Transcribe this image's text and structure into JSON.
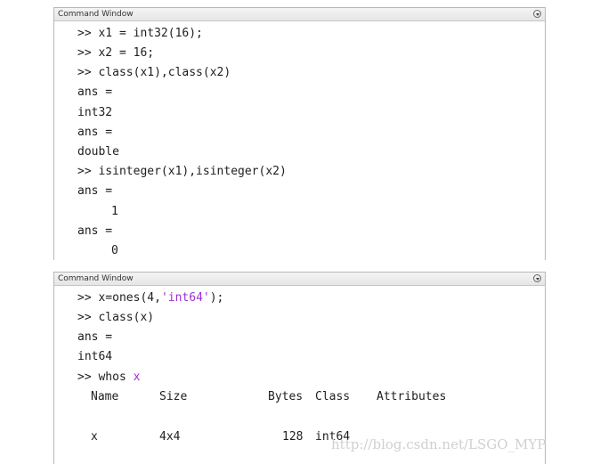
{
  "window1": {
    "title": "Command Window",
    "lines": [
      {
        "prompt": ">> ",
        "code": "x1 = int32(16);"
      },
      {
        "prompt": ">> ",
        "code": "x2 = 16;"
      },
      {
        "prompt": ">> ",
        "code": "class(x1),class(x2)"
      },
      {
        "text": "ans ="
      },
      {
        "text": "int32"
      },
      {
        "text": "ans ="
      },
      {
        "text": "double"
      },
      {
        "prompt": ">> ",
        "code": "isinteger(x1),isinteger(x2)"
      },
      {
        "text": "ans ="
      },
      {
        "text": "1"
      },
      {
        "text": "ans ="
      },
      {
        "text": "0"
      }
    ]
  },
  "window2": {
    "title": "Command Window",
    "lines": [
      {
        "prompt": ">> ",
        "code_before": "x=ones(4,",
        "string": "'int64'",
        "code_after": ");"
      },
      {
        "prompt": ">> ",
        "code": "class(x)"
      },
      {
        "text": "ans ="
      },
      {
        "text": "int64"
      },
      {
        "prompt": ">> ",
        "code_before": "whos ",
        "var": "x"
      }
    ],
    "whos_table": {
      "headers": [
        "Name",
        "Size",
        "Bytes",
        "Class",
        "Attributes"
      ],
      "rows": [
        [
          "x",
          "4x4",
          "128",
          "int64",
          ""
        ]
      ]
    }
  },
  "watermark": "http://blog.csdn.net/LSGO_MYP",
  "colors": {
    "string": "#9b2fd1",
    "text": "#1e1e1e"
  },
  "icons": {
    "menu": "dropdown-menu-icon"
  }
}
